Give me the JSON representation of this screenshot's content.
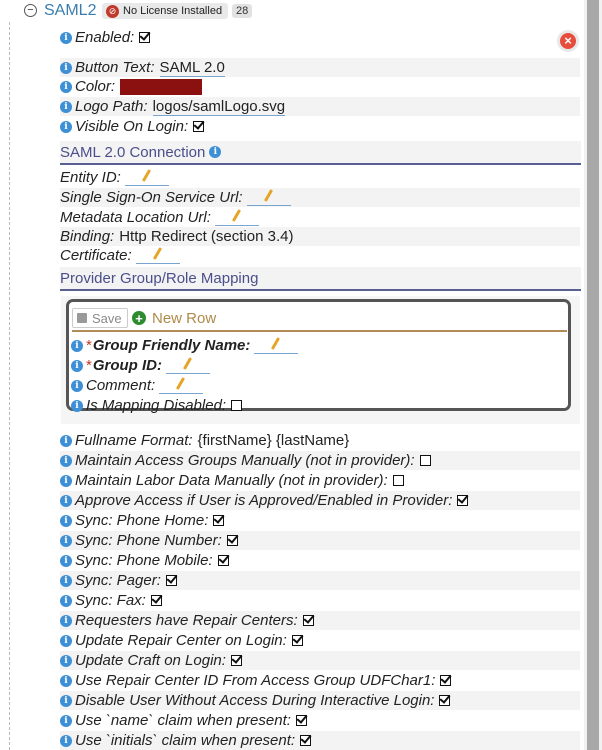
{
  "header": {
    "title": "SAML2",
    "license_badge": "No License Installed",
    "count": "28"
  },
  "fields": {
    "enabled": {
      "label": "Enabled:",
      "checked": true
    },
    "button_text": {
      "label": "Button Text:",
      "value": "SAML 2.0"
    },
    "color": {
      "label": "Color:",
      "value": "#8b1111"
    },
    "logo_path": {
      "label": "Logo Path:",
      "value": "logos/samlLogo.svg"
    },
    "visible_on_login": {
      "label": "Visible On Login:",
      "checked": true
    }
  },
  "connection": {
    "title": "SAML 2.0 Connection",
    "entity_id": "Entity ID:",
    "sso_url": "Single Sign-On Service Url:",
    "metadata_url": "Metadata Location Url:",
    "binding_label": "Binding:",
    "binding_value": "Http Redirect (section 3.4)",
    "certificate": "Certificate:"
  },
  "mapping": {
    "title": "Provider Group/Role Mapping",
    "save_label": "Save",
    "new_row_label": "New Row",
    "group_friendly_name": "Group Friendly Name:",
    "group_id": "Group ID:",
    "comment": "Comment:",
    "is_mapping_disabled": "Is Mapping Disabled:"
  },
  "options": [
    {
      "label": "Fullname Format:",
      "value": "{firstName} {lastName}"
    },
    {
      "label": "Maintain Access Groups Manually (not in provider):",
      "checked": false
    },
    {
      "label": "Maintain Labor Data Manually (not in provider):",
      "checked": false
    },
    {
      "label": "Approve Access if User is Approved/Enabled in Provider:",
      "checked": true
    },
    {
      "label": "Sync: Phone Home:",
      "checked": true
    },
    {
      "label": "Sync: Phone Number:",
      "checked": true
    },
    {
      "label": "Sync: Phone Mobile:",
      "checked": true
    },
    {
      "label": "Sync: Pager:",
      "checked": true
    },
    {
      "label": "Sync: Fax:",
      "checked": true
    },
    {
      "label": "Requesters have Repair Centers:",
      "checked": true
    },
    {
      "label": "Update Repair Center on Login:",
      "checked": true
    },
    {
      "label": "Update Craft on Login:",
      "checked": true
    },
    {
      "label": "Use Repair Center ID From Access Group UDFChar1:",
      "checked": true
    },
    {
      "label": "Disable User Without Access During Interactive Login:",
      "checked": true
    },
    {
      "label": "Use `name` claim when present:",
      "checked": true
    },
    {
      "label": "Use `initials` claim when present:",
      "checked": true
    }
  ]
}
